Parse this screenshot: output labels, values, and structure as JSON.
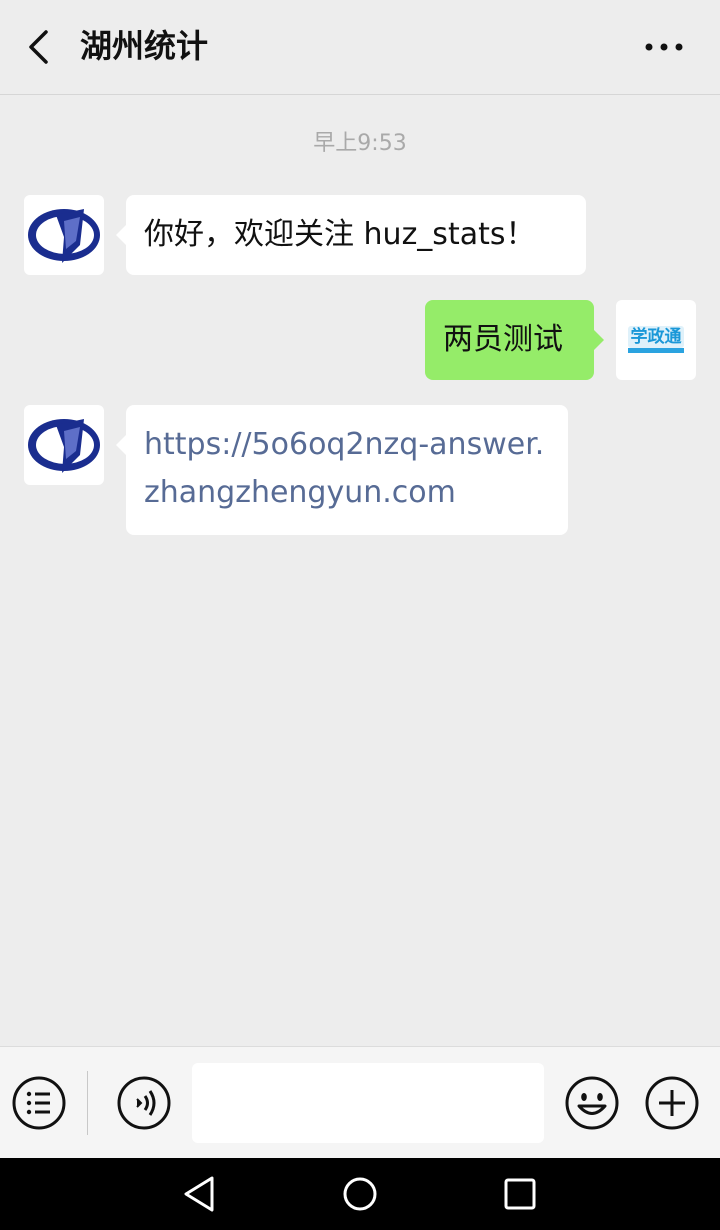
{
  "header": {
    "title": "湖州统计",
    "back_icon": "chevron-left-icon",
    "more_icon": "more-dots-icon"
  },
  "chat": {
    "timestamp": "早上9:53",
    "messages": [
      {
        "side": "left",
        "text": "你好，欢迎关注 huz_stats！"
      },
      {
        "side": "right",
        "text": "两员测试"
      },
      {
        "side": "left",
        "text": "https://5o6oq2nzq-answer.zhangzhengyun.com",
        "is_link": true
      }
    ],
    "self_avatar_text": "学政通"
  },
  "input_bar": {
    "menu_icon": "menu-list-icon",
    "voice_icon": "voice-icon",
    "emoji_icon": "emoji-icon",
    "plus_icon": "plus-icon",
    "text_value": ""
  },
  "colors": {
    "background": "#ededed",
    "sent_bubble": "#95ec69",
    "received_bubble": "#ffffff",
    "link": "#576b95",
    "brand_blue": "#1a2d8f"
  }
}
